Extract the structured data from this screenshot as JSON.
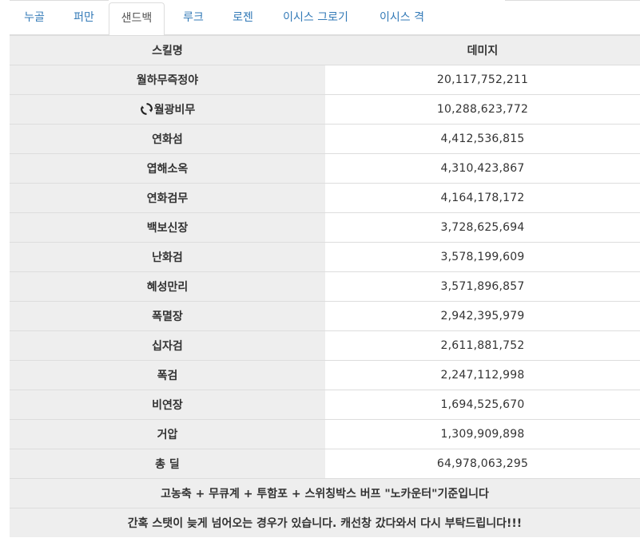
{
  "tabs": [
    {
      "label": "누골",
      "active": false
    },
    {
      "label": "퍼만",
      "active": false
    },
    {
      "label": "샌드백",
      "active": true
    },
    {
      "label": "루크",
      "active": false
    },
    {
      "label": "로젠",
      "active": false
    },
    {
      "label": "이시스 그로기",
      "active": false
    },
    {
      "label": "이시스 격",
      "active": false
    }
  ],
  "table": {
    "headers": {
      "skill": "스킬명",
      "damage": "데미지"
    },
    "rows": [
      {
        "skill": "월하무즉정야",
        "damage": "20,117,752,211"
      },
      {
        "skill": "월광비무",
        "damage": "10,288,623,772",
        "icon": "cycle-icon"
      },
      {
        "skill": "연화섬",
        "damage": "4,412,536,815"
      },
      {
        "skill": "엽해소옥",
        "damage": "4,310,423,867"
      },
      {
        "skill": "연화검무",
        "damage": "4,164,178,172"
      },
      {
        "skill": "백보신장",
        "damage": "3,728,625,694"
      },
      {
        "skill": "난화검",
        "damage": "3,578,199,609"
      },
      {
        "skill": "혜성만리",
        "damage": "3,571,896,857"
      },
      {
        "skill": "폭멸장",
        "damage": "2,942,395,979"
      },
      {
        "skill": "십자검",
        "damage": "2,611,881,752"
      },
      {
        "skill": "폭검",
        "damage": "2,247,112,998"
      },
      {
        "skill": "비연장",
        "damage": "1,694,525,670"
      },
      {
        "skill": "거압",
        "damage": "1,309,909,898"
      }
    ],
    "total": {
      "label": "총 딜",
      "damage": "64,978,063,295"
    },
    "notes": [
      "고농축 + 무큐계 + 투함포 + 스위칭박스 버프 \"노카운터\"기준입니다",
      "간혹 스탯이 늦게 넘어오는 경우가 있습니다. 캐선창 갔다와서 다시 부탁드립니다!!!"
    ]
  }
}
